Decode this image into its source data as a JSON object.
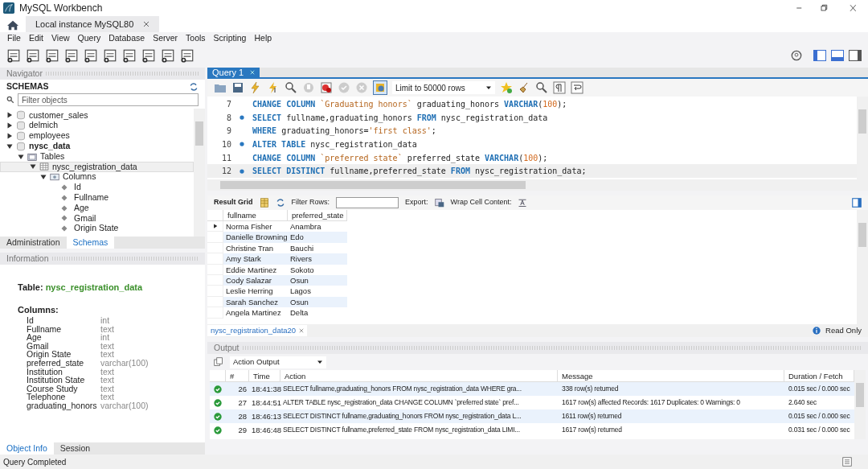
{
  "window": {
    "title": "MySQL Workbench"
  },
  "connection_tabs": [
    {
      "label": "Local instance MySQL80",
      "selected": true
    }
  ],
  "menu": [
    "File",
    "Edit",
    "View",
    "Query",
    "Database",
    "Server",
    "Tools",
    "Scripting",
    "Help"
  ],
  "navigator": {
    "title": "Navigator",
    "section": "SCHEMAS",
    "filter": {
      "placeholder": "Filter objects"
    },
    "tree": [
      {
        "label": "customer_sales",
        "kind": "schema",
        "expanded": false,
        "default": false,
        "selected": false
      },
      {
        "label": "delmich",
        "kind": "schema",
        "expanded": false,
        "default": false,
        "selected": false
      },
      {
        "label": "employees",
        "kind": "schema",
        "expanded": false,
        "default": false,
        "selected": false
      },
      {
        "label": "nysc_data",
        "kind": "schema",
        "expanded": true,
        "default": true,
        "selected": false,
        "children": [
          {
            "label": "Tables",
            "kind": "folder",
            "expanded": true,
            "selected": false,
            "children": [
              {
                "label": "nysc_registration_data",
                "kind": "table",
                "expanded": true,
                "selected": true,
                "children": [
                  {
                    "label": "Columns",
                    "kind": "columns",
                    "expanded": true,
                    "selected": false,
                    "children": [
                      {
                        "label": "Id",
                        "kind": "column",
                        "selected": false
                      },
                      {
                        "label": "Fullname",
                        "kind": "column",
                        "selected": false
                      },
                      {
                        "label": "Age",
                        "kind": "column",
                        "selected": false
                      },
                      {
                        "label": "Gmail",
                        "kind": "column",
                        "selected": false
                      },
                      {
                        "label": "Origin State",
                        "kind": "column",
                        "selected": false
                      }
                    ]
                  }
                ]
              }
            ]
          }
        ]
      }
    ],
    "tabs": [
      {
        "label": "Administration",
        "selected": false
      },
      {
        "label": "Schemas",
        "selected": true
      }
    ]
  },
  "information": {
    "title": "Information",
    "heading_label": "Table:",
    "table_name": "nysc_registration_data",
    "columns_label": "Columns:",
    "columns": [
      {
        "name": "Id",
        "type": "int"
      },
      {
        "name": "Fullname",
        "type": "text"
      },
      {
        "name": "Age",
        "type": "int"
      },
      {
        "name": "Gmail",
        "type": "text"
      },
      {
        "name": "Origin State",
        "type": "text"
      },
      {
        "name": "preferred_state",
        "type": "varchar(100)"
      },
      {
        "name": "Institution",
        "type": "text"
      },
      {
        "name": "Institution State",
        "type": "text"
      },
      {
        "name": "Course Study",
        "type": "text"
      },
      {
        "name": "Telephone",
        "type": "text"
      },
      {
        "name": "graduating_honors",
        "type": "varchar(100)"
      }
    ],
    "tabs": [
      {
        "label": "Object Info",
        "selected": true
      },
      {
        "label": "Session",
        "selected": false
      }
    ]
  },
  "query_tabs": [
    {
      "label": "Query 1",
      "selected": true
    }
  ],
  "editor": {
    "limit": "Limit to 50000 rows",
    "lines": [
      {
        "number": "7",
        "statement_start": false,
        "current": false,
        "tokens": [
          {
            "kind": "keyword",
            "text": "CHANGE COLUMN"
          },
          {
            "kind": "string",
            "text": " `Graduating honors`"
          },
          {
            "kind": "plain",
            "text": " graduating_honors "
          },
          {
            "kind": "keyword",
            "text": "VARCHAR"
          },
          {
            "kind": "plain",
            "text": "("
          },
          {
            "kind": "number",
            "text": "100"
          },
          {
            "kind": "plain",
            "text": ");"
          }
        ]
      },
      {
        "number": "8",
        "statement_start": true,
        "current": false,
        "tokens": [
          {
            "kind": "keyword",
            "text": "SELECT"
          },
          {
            "kind": "plain",
            "text": " fullname,graduating_honors "
          },
          {
            "kind": "keyword",
            "text": "FROM"
          },
          {
            "kind": "plain",
            "text": " nysc_registration_data"
          }
        ]
      },
      {
        "number": "9",
        "statement_start": false,
        "current": false,
        "tokens": [
          {
            "kind": "keyword",
            "text": "WHERE"
          },
          {
            "kind": "plain",
            "text": " graduating_honors="
          },
          {
            "kind": "string",
            "text": "'first class'"
          },
          {
            "kind": "plain",
            "text": ";"
          }
        ]
      },
      {
        "number": "10",
        "statement_start": true,
        "current": false,
        "tokens": [
          {
            "kind": "keyword",
            "text": "ALTER TABLE"
          },
          {
            "kind": "plain",
            "text": " nysc_registration_data"
          }
        ]
      },
      {
        "number": "11",
        "statement_start": false,
        "current": false,
        "tokens": [
          {
            "kind": "keyword",
            "text": "CHANGE COLUMN"
          },
          {
            "kind": "string",
            "text": " `preferred state`"
          },
          {
            "kind": "plain",
            "text": " preferred_state "
          },
          {
            "kind": "keyword",
            "text": "VARCHAR"
          },
          {
            "kind": "plain",
            "text": "("
          },
          {
            "kind": "number",
            "text": "100"
          },
          {
            "kind": "plain",
            "text": ");"
          }
        ]
      },
      {
        "number": "12",
        "statement_start": true,
        "current": true,
        "tokens": [
          {
            "kind": "keyword",
            "text": "SELECT DISTINCT"
          },
          {
            "kind": "plain",
            "text": " fullname,preferred_state "
          },
          {
            "kind": "keyword",
            "text": "FROM"
          },
          {
            "kind": "plain",
            "text": " nysc_registration_data;"
          }
        ]
      }
    ]
  },
  "result": {
    "label": "Result Grid",
    "filter_label": "Filter Rows:",
    "export_label": "Export:",
    "wrap_label": "Wrap Cell Content:",
    "columns": [
      "fullname",
      "preferred_state"
    ],
    "rows": [
      {
        "cells": [
          "Norma Fisher",
          "Anambra"
        ],
        "current": true
      },
      {
        "cells": [
          "Danielle Browning",
          "Edo"
        ],
        "current": false
      },
      {
        "cells": [
          "Christine Tran",
          "Bauchi"
        ],
        "current": false
      },
      {
        "cells": [
          "Amy Stark",
          "Rivers"
        ],
        "current": false
      },
      {
        "cells": [
          "Eddie Martinez",
          "Sokoto"
        ],
        "current": false
      },
      {
        "cells": [
          "Cody Salazar",
          "Osun"
        ],
        "current": false
      },
      {
        "cells": [
          "Leslie Herring",
          "Lagos"
        ],
        "current": false
      },
      {
        "cells": [
          "Sarah Sanchez",
          "Osun"
        ],
        "current": false
      },
      {
        "cells": [
          "Angela Martinez",
          "Delta"
        ],
        "current": false
      }
    ],
    "tab": "nysc_registration_data20",
    "read_only": "Read Only"
  },
  "output": {
    "title": "Output",
    "selector": "Action Output",
    "columns": [
      "#",
      "Time",
      "Action",
      "Message",
      "Duration / Fetch"
    ],
    "rows": [
      {
        "kind": "success",
        "number": "26",
        "time": "18:41:38",
        "action": "SELECT fullname,graduating_honors FROM nysc_registration_data WHERE gra...",
        "message": "338 row(s) returned",
        "duration": "0.015 sec / 0.000 sec"
      },
      {
        "kind": "success",
        "number": "27",
        "time": "18:44:51",
        "action": "ALTER TABLE nysc_registration_data CHANGE COLUMN `preferred state` pref...",
        "message": "1617 row(s) affected Records: 1617  Duplicates: 0  Warnings: 0",
        "duration": "2.640 sec"
      },
      {
        "kind": "success",
        "number": "28",
        "time": "18:46:13",
        "action": "SELECT DISTINCT fullname,graduating_honors FROM nysc_registration_data L...",
        "message": "1611 row(s) returned",
        "duration": "0.015 sec / 0.000 sec"
      },
      {
        "kind": "success",
        "number": "29",
        "time": "18:46:48",
        "action": "SELECT DISTINCT fullname,preferred_state FROM nysc_registration_data LIMI...",
        "message": "1617 row(s) returned",
        "duration": "0.031 sec / 0.000 sec"
      }
    ]
  },
  "status_bar": "Query Completed"
}
